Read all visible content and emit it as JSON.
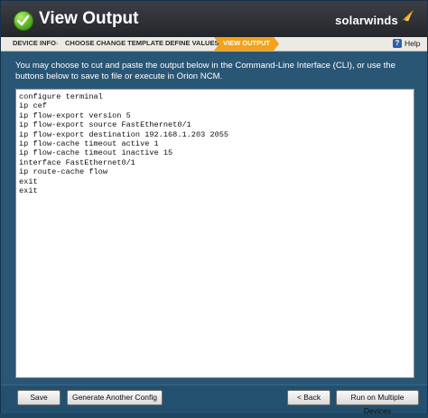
{
  "window": {
    "title": "View Output",
    "logo_text": "solarwinds"
  },
  "breadcrumb": {
    "items": [
      {
        "label": "DEVICE INFO"
      },
      {
        "label": "CHOOSE CHANGE TEMPLATE"
      },
      {
        "label": "DEFINE VALUES"
      },
      {
        "label": "VIEW OUTPUT",
        "active": true
      }
    ],
    "separator": "›",
    "help_label": "Help",
    "help_icon": "?"
  },
  "instructions": "You may choose to cut and paste the output below in the Command-Line Interface (CLI), or use the buttons below to save to file or execute in Orion NCM.",
  "output_text": "configure terminal\nip cef\nip flow-export version 5\nip flow-export source FastEthernet0/1\nip flow-export destination 192.168.1.203 2055\nip flow-cache timeout active 1\nip flow-cache timeout inactive 15\ninterface FastEthernet0/1\nip route-cache flow\nexit\nexit",
  "buttons": {
    "save": "Save",
    "generate": "Generate Another Config",
    "back": "< Back",
    "run": "Run on Multiple Devices"
  },
  "colors": {
    "accent": "#f2a31b",
    "background": "#2a5675",
    "titlebar": "#2e3035"
  },
  "icons": {
    "title_icon": "check-icon",
    "logo_icon": "solarwinds-flame-icon",
    "help_icon": "help-icon"
  }
}
